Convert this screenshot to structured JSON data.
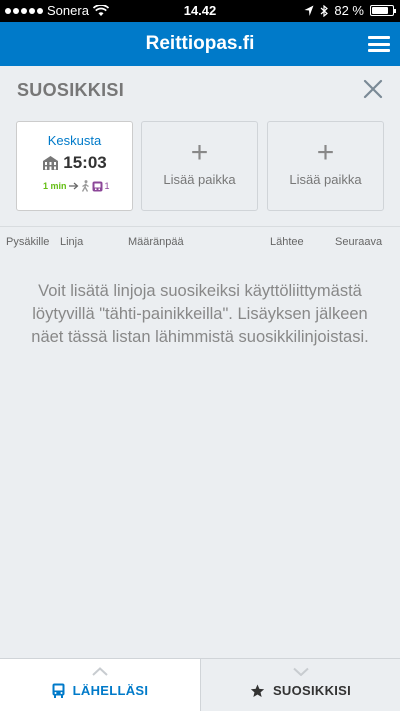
{
  "status_bar": {
    "carrier": "Sonera",
    "time": "14.42",
    "battery": "82 %",
    "battery_level": 0.82
  },
  "app": {
    "title": "Reittiopas.fi",
    "brand_color": "#007ac9"
  },
  "favourites": {
    "title": "SUOSIKKISI",
    "places": [
      {
        "name": "Keskusta",
        "icon": "building-icon",
        "time": "15:03",
        "walk": "1 min",
        "vehicle_number": "1"
      },
      {
        "plus": "+",
        "label": "Lisää paikka"
      },
      {
        "plus": "+",
        "label": "Lisää paikka"
      }
    ]
  },
  "columns": [
    "Pysäkille",
    "Linja",
    "Määränpää",
    "Lähtee",
    "Seuraava"
  ],
  "empty_message": "Voit lisätä linjoja suosikeiksi käyttöliittymästä löytyvillä \"tähti-painikkeilla\". Lisäyksen jälkeen näet tässä listan lähimmistä suosikkilinjoistasi.",
  "bottom_nav": {
    "left_label": "LÄHELLÄSI",
    "right_label": "SUOSIKKISI"
  }
}
